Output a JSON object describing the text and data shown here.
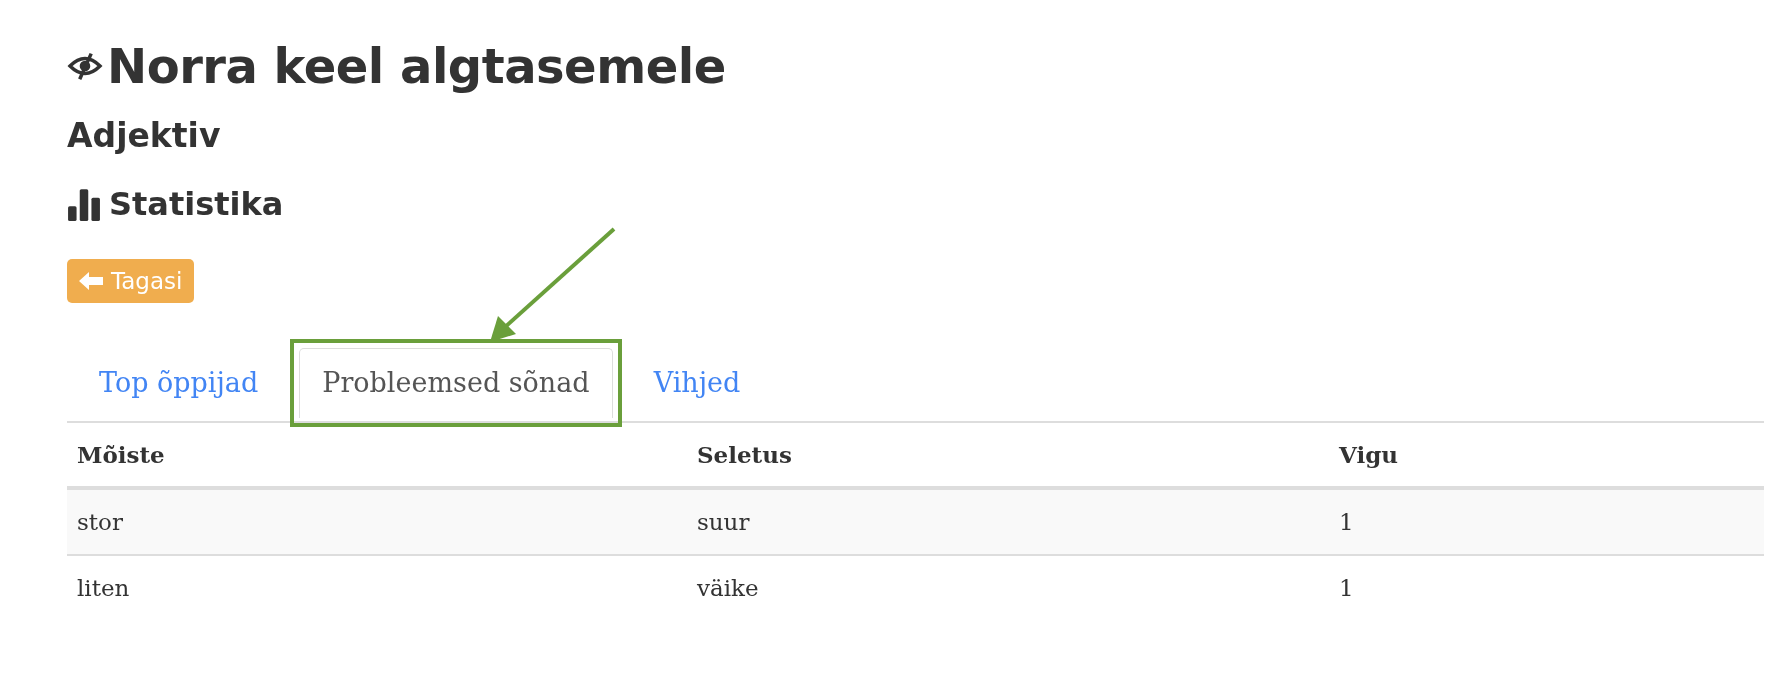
{
  "title": "Norra keel algtasemele",
  "subtitle": "Adjektiv",
  "section": "Statistika",
  "back_button": "Tagasi",
  "tabs": [
    {
      "label": "Top õppijad",
      "selected": false,
      "highlighted": false
    },
    {
      "label": "Probleemsed sõnad",
      "selected": true,
      "highlighted": true
    },
    {
      "label": "Vihjed",
      "selected": false,
      "highlighted": false
    }
  ],
  "table": {
    "columns": [
      "Mõiste",
      "Seletus",
      "Vigu"
    ],
    "rows": [
      [
        "stor",
        "suur",
        "1"
      ],
      [
        "liten",
        "väike",
        "1"
      ]
    ]
  }
}
